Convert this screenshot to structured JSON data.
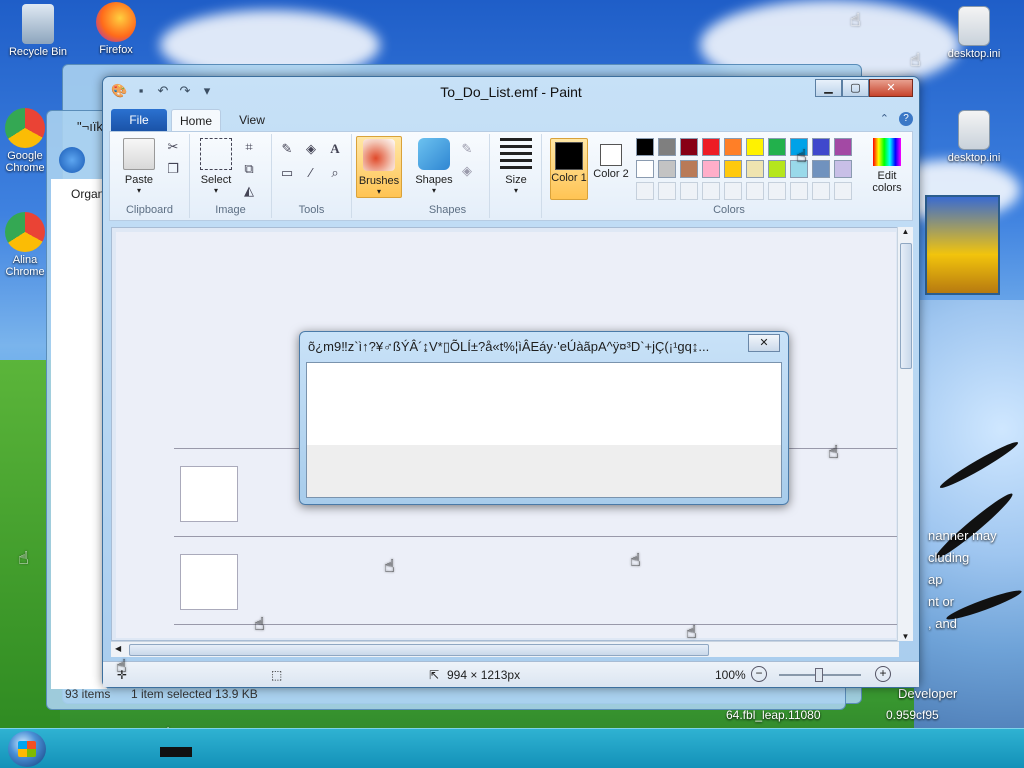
{
  "desktop": {
    "icons_left": [
      {
        "label": "Recycle Bin"
      },
      {
        "label": "Firefox"
      },
      {
        "label": "Google Chrome"
      },
      {
        "label": "Alina Chrome"
      }
    ],
    "icons_right": [
      {
        "label": "desktop.ini"
      },
      {
        "label": "desktop.ini"
      }
    ]
  },
  "explorer_back": {
    "title": "\"¬ıïk",
    "organize": "Organ",
    "status_items": "93 items",
    "status_selected": "1 item selected  13.9 KB"
  },
  "background_text": {
    "lines": [
      "nanner may",
      "cluding",
      "ap",
      "nt or",
      ", and"
    ],
    "developer": "Developer",
    "build": "64.fbl_leap.11080",
    "hash": "0.959cf95"
  },
  "paint": {
    "title": "To_Do_List.emf - Paint",
    "tabs": {
      "file": "File",
      "home": "Home",
      "view": "View"
    },
    "groups": {
      "clipboard": "Clipboard",
      "image": "Image",
      "tools": "Tools",
      "shapes": "Shapes",
      "colors": "Colors"
    },
    "buttons": {
      "paste": "Paste",
      "select": "Select",
      "brushes": "Brushes",
      "shapes": "Shapes",
      "size": "Size",
      "color1": "Color 1",
      "color2": "Color 2",
      "edit_colors": "Edit colors"
    },
    "palette_row1": [
      "#000000",
      "#7f7f7f",
      "#880015",
      "#ed1c24",
      "#ff7f27",
      "#fff200",
      "#22b14c",
      "#00a2e8",
      "#3f48cc",
      "#a349a4"
    ],
    "palette_row2": [
      "#ffffff",
      "#c3c3c3",
      "#b97a57",
      "#ffaec9",
      "#ffc90e",
      "#efe4b0",
      "#b5e61d",
      "#99d9ea",
      "#7092be",
      "#c8bfe7"
    ],
    "color1_value": "#000000",
    "color2_value": "#ffffff",
    "status": {
      "dimensions": "994 × 1213px",
      "zoom": "100%"
    }
  },
  "dialog": {
    "title": "õ¿m9‼z`ì↑?¥♂ßÝÂ´↨V*▯ÕLÍ±?å«t%¦ìÂEáy·'eÚàãpA^ÿ¤³D`+jÇ(¡¹gq↨..."
  }
}
